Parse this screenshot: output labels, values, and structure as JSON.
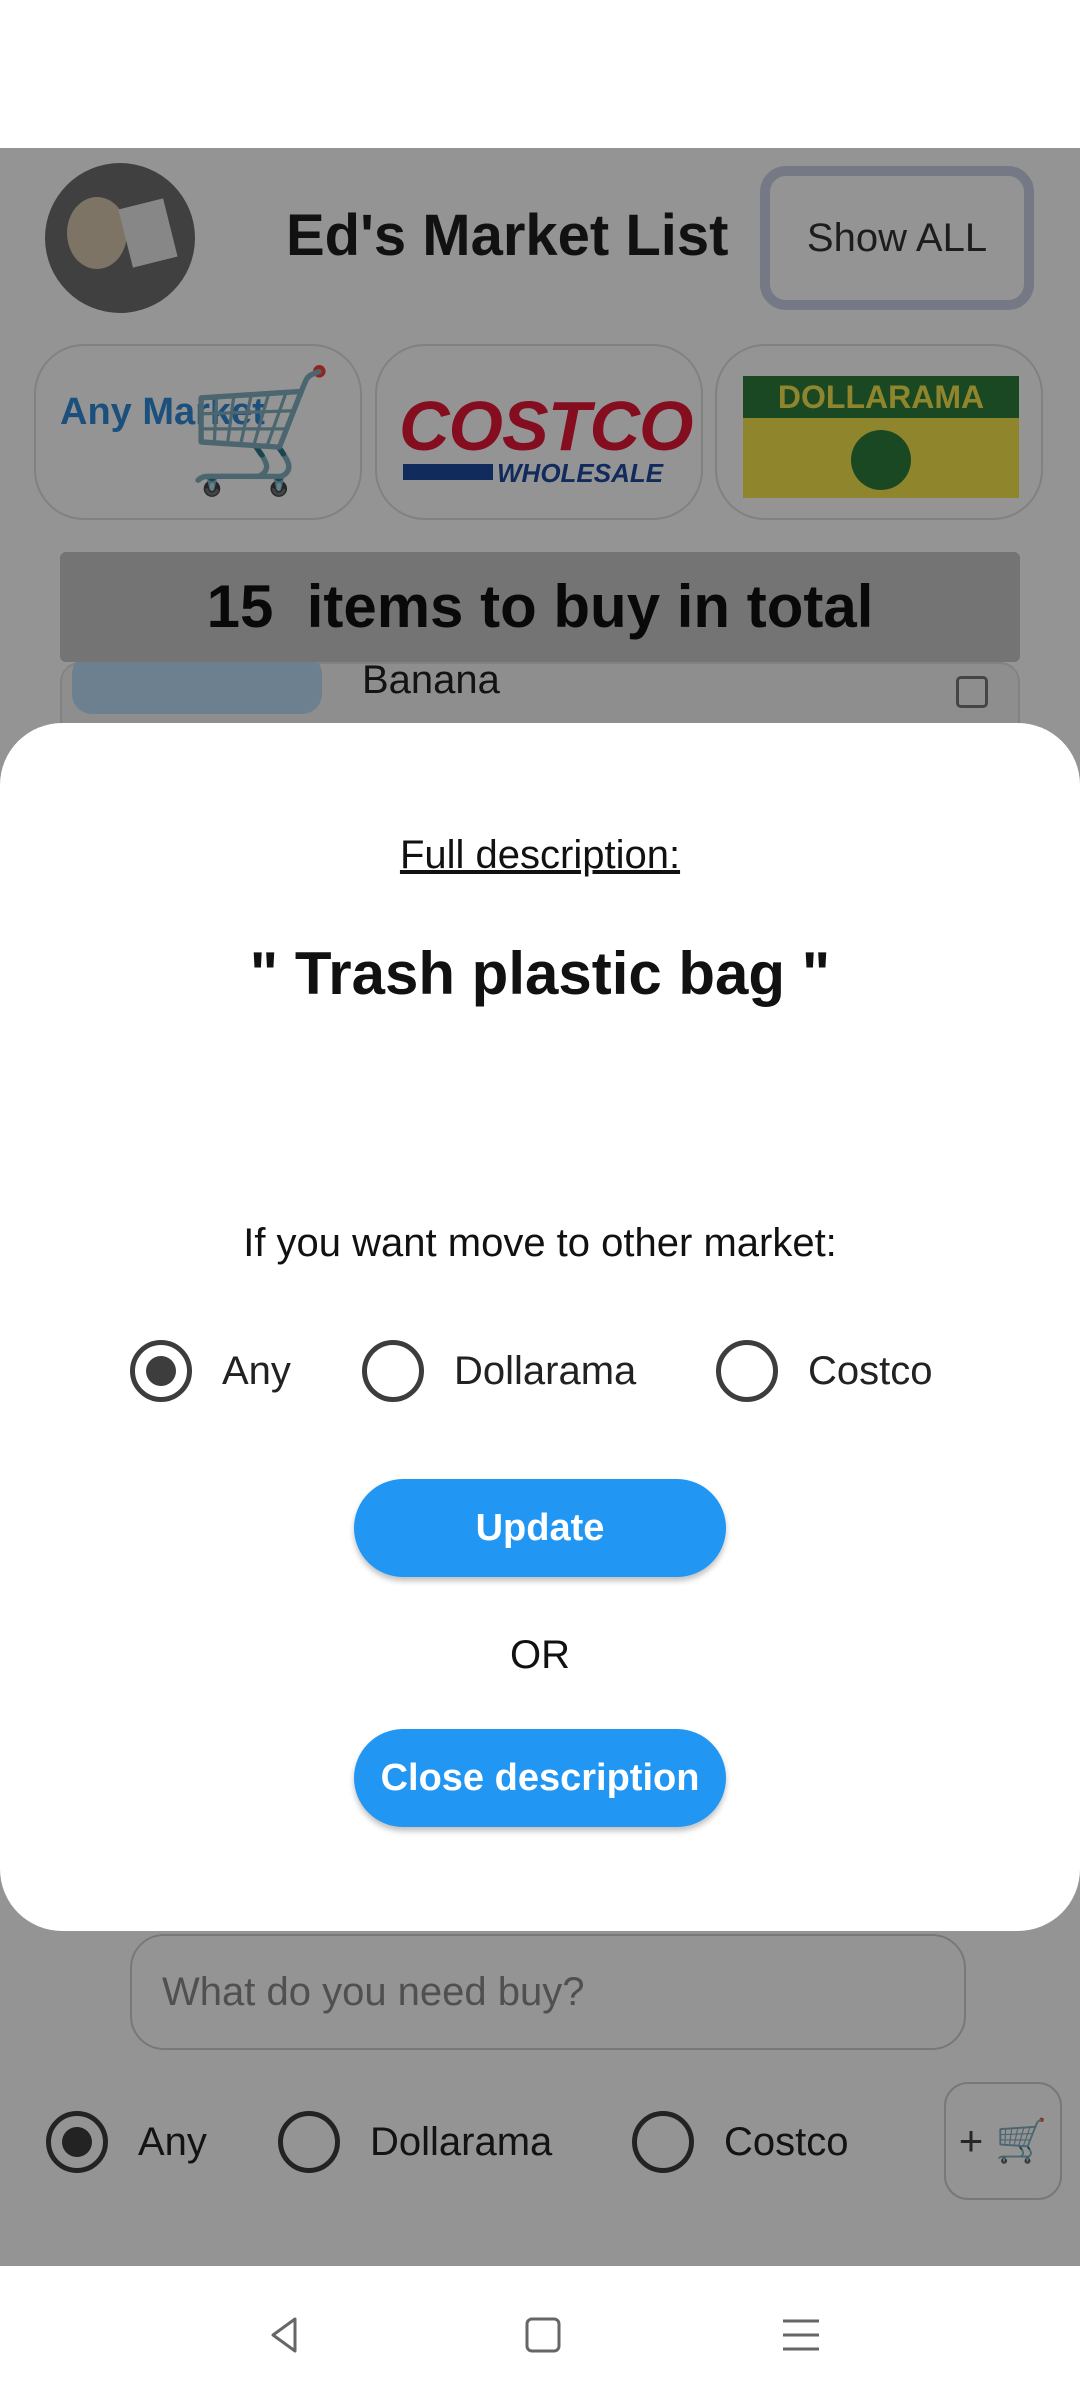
{
  "app": {
    "title": "Ed's Market List",
    "show_all_label": "Show ALL"
  },
  "markets": {
    "any_logo_text": "Any Market",
    "costco_logo_text": "COSTCO",
    "costco_logo_sub": "WHOLESALE",
    "dollarama_logo_text": "DOLLARAMA"
  },
  "summary": {
    "count_text": "15  items to buy in total"
  },
  "list": {
    "items": [
      {
        "label": "Banana"
      }
    ]
  },
  "new_item": {
    "placeholder": "What do you need buy?",
    "add_button_label": "+ 🛒"
  },
  "bottom_radios": {
    "options": [
      "Any",
      "Dollarama",
      "Costco"
    ],
    "selected": "Any"
  },
  "modal": {
    "heading": "Full description:",
    "description": "\" Trash plastic bag \"",
    "move_prompt": "If you want move to other market:",
    "options": [
      "Any",
      "Dollarama",
      "Costco"
    ],
    "selected": "Any",
    "update_label": "Update",
    "or_label": "OR",
    "close_label": "Close description"
  },
  "colors": {
    "primary_button": "#2196f3",
    "overlay": "rgba(0,0,0,0.42)"
  }
}
